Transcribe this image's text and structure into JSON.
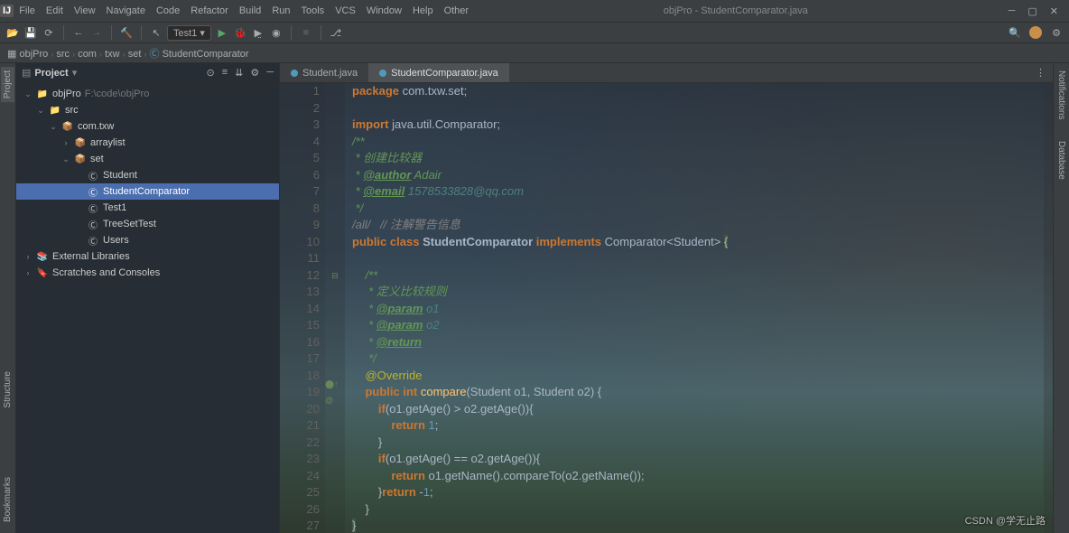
{
  "window": {
    "title": "objPro - StudentComparator.java"
  },
  "menubar": [
    "File",
    "Edit",
    "View",
    "Navigate",
    "Code",
    "Refactor",
    "Build",
    "Run",
    "Tools",
    "VCS",
    "Window",
    "Help",
    "Other"
  ],
  "toolbar": {
    "run_config": "Test1 ▾",
    "right_avatar_color": "#c98f4a"
  },
  "breadcrumbs": [
    "objPro",
    "src",
    "com",
    "txw",
    "set",
    "StudentComparator"
  ],
  "project_panel": {
    "title": "Project",
    "tree": [
      {
        "d": 0,
        "exp": true,
        "ico": "📁",
        "label": "objPro",
        "hint": "F:\\code\\objPro",
        "sel": false
      },
      {
        "d": 1,
        "exp": true,
        "ico": "📁",
        "label": "src",
        "sel": false
      },
      {
        "d": 2,
        "exp": true,
        "ico": "📦",
        "label": "com.txw",
        "sel": false
      },
      {
        "d": 3,
        "exp": false,
        "ico": "📦",
        "label": "arraylist",
        "sel": false,
        "chev": "›"
      },
      {
        "d": 3,
        "exp": true,
        "ico": "📦",
        "label": "set",
        "sel": false
      },
      {
        "d": 4,
        "ico": "Ⓒ",
        "label": "Student",
        "sel": false
      },
      {
        "d": 4,
        "ico": "Ⓒ",
        "label": "StudentComparator",
        "sel": true
      },
      {
        "d": 4,
        "ico": "Ⓒ",
        "label": "Test1",
        "sel": false
      },
      {
        "d": 4,
        "ico": "Ⓒ",
        "label": "TreeSetTest",
        "sel": false
      },
      {
        "d": 4,
        "ico": "Ⓒ",
        "label": "Users",
        "sel": false
      },
      {
        "d": 0,
        "chev": "›",
        "ico": "📚",
        "label": "External Libraries",
        "sel": false
      },
      {
        "d": 0,
        "chev": "›",
        "ico": "🔖",
        "label": "Scratches and Consoles",
        "sel": false
      }
    ]
  },
  "editor_tabs": [
    {
      "label": "Student.java",
      "active": false
    },
    {
      "label": "StudentComparator.java",
      "active": true
    }
  ],
  "left_tool_tabs": [
    {
      "label": "Project",
      "active": true
    },
    {
      "label": "Bookmarks",
      "active": false
    },
    {
      "label": "Structure",
      "active": false
    }
  ],
  "right_tool_tabs": [
    {
      "label": "Notifications"
    },
    {
      "label": "Database"
    }
  ],
  "code_lines": [
    "<span class='kw'>package</span> <span class='pkg'>com.txw.set</span>;",
    "",
    "<span class='kw'>import</span> <span class='pkg'>java.util.</span><span class='cls'>Comparator</span>;",
    "<span class='doc'>/**</span>",
    "<span class='doc'> * 创建比较器</span>",
    "<span class='doc'> * <span class='doctag'>@author</span> Adair</span>",
    "<span class='doc'> * <span class='doctag'>@email</span> <span class='tagref'>1578533828@qq.com</span></span>",
    "<span class='doc'> */</span>",
    "<span class='cmt'>/all/   // 注解警告信息</span>",
    "<span class='kw'>public</span> <span class='kw'>class</span> <span class='boldcls'>StudentComparator</span> <span class='kw'>implements</span> <span class='cls'>Comparator</span>&lt;<span class='cls'>Student</span>&gt; <span class='braceh'>{</span>",
    "",
    "    <span class='doc'>/**</span>",
    "    <span class='doc'> * 定义比较规则</span>",
    "    <span class='doc'> * <span class='doctag'>@param</span> <span class='tagref'>o1</span></span>",
    "    <span class='doc'> * <span class='doctag'>@param</span> <span class='tagref'>o2</span></span>",
    "    <span class='doc'> * <span class='doctag'>@return</span></span>",
    "    <span class='doc'> */</span>",
    "    <span class='ann'>@Override</span>",
    "    <span class='kw'>public</span> <span class='kw'>int</span> <span class='id'>compare</span>(<span class='cls'>Student</span> o1, <span class='cls'>Student</span> o2) {",
    "        <span class='kw'>if</span>(o1.getAge() &gt; o2.getAge()){",
    "            <span class='kw'>return</span> <span class='num'>1</span>;",
    "        }",
    "        <span class='kw'>if</span>(o1.getAge() == o2.getAge()){",
    "            <span class='kw'>return</span> o1.getName().compareTo(o2.getName());",
    "        }<span class='kw'>return</span> -<span class='num'>1</span>;",
    "    }",
    "<span class='braceh'>}</span>"
  ],
  "gutter_marks": {
    "19": "⬤↑ @",
    "12": "⊟"
  },
  "watermark": "CSDN @学无止路"
}
